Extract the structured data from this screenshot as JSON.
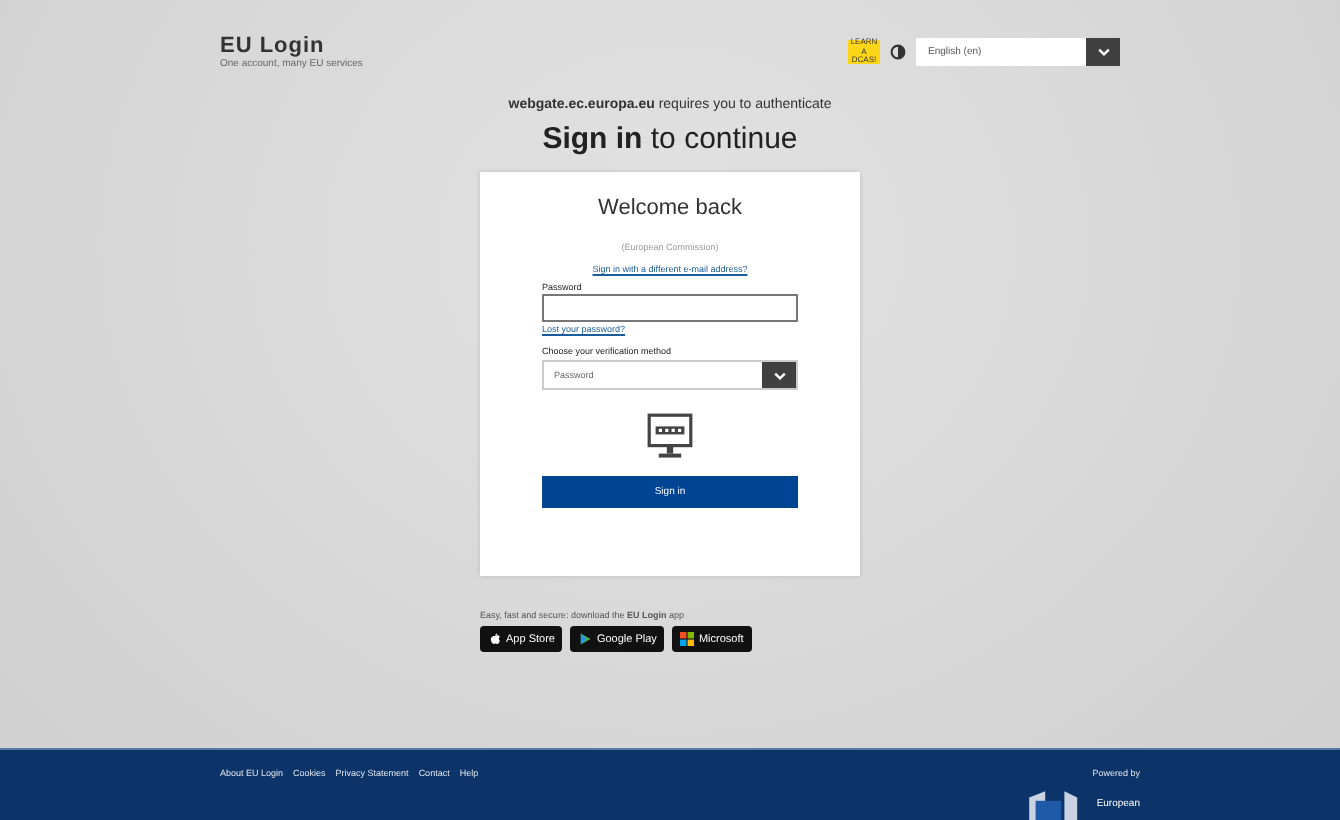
{
  "header": {
    "title": "EU Login",
    "subtitle": "One account, many EU services",
    "badge": "LEARN A DCAS!",
    "language": "English (en)"
  },
  "auth_notice": {
    "site": "webgate.ec.europa.eu",
    "text": "requires you to authenticate"
  },
  "heading": {
    "strong": "Sign in",
    "rest": "to continue"
  },
  "card": {
    "welcome": "Welcome back",
    "organisation": "(European Commission)",
    "switch_link": "Sign in with a different e-mail address?",
    "password_label": "Password",
    "forgot_link": "Lost your password?",
    "method_label": "Choose your verification method",
    "method_value": "Password",
    "submit": "Sign in"
  },
  "app_promo": {
    "text": "Easy, fast and secure: download the **EU Login** app",
    "stores": [
      {
        "kind": "apple",
        "label": "App Store"
      },
      {
        "kind": "google",
        "label": "Google Play"
      },
      {
        "kind": "microsoft",
        "label": "Microsoft"
      }
    ]
  },
  "footer": {
    "links": [
      "About EU Login",
      "Cookies",
      "Privacy Statement",
      "Contact",
      "Help"
    ],
    "powered_by": "Powered by",
    "org": "European"
  }
}
